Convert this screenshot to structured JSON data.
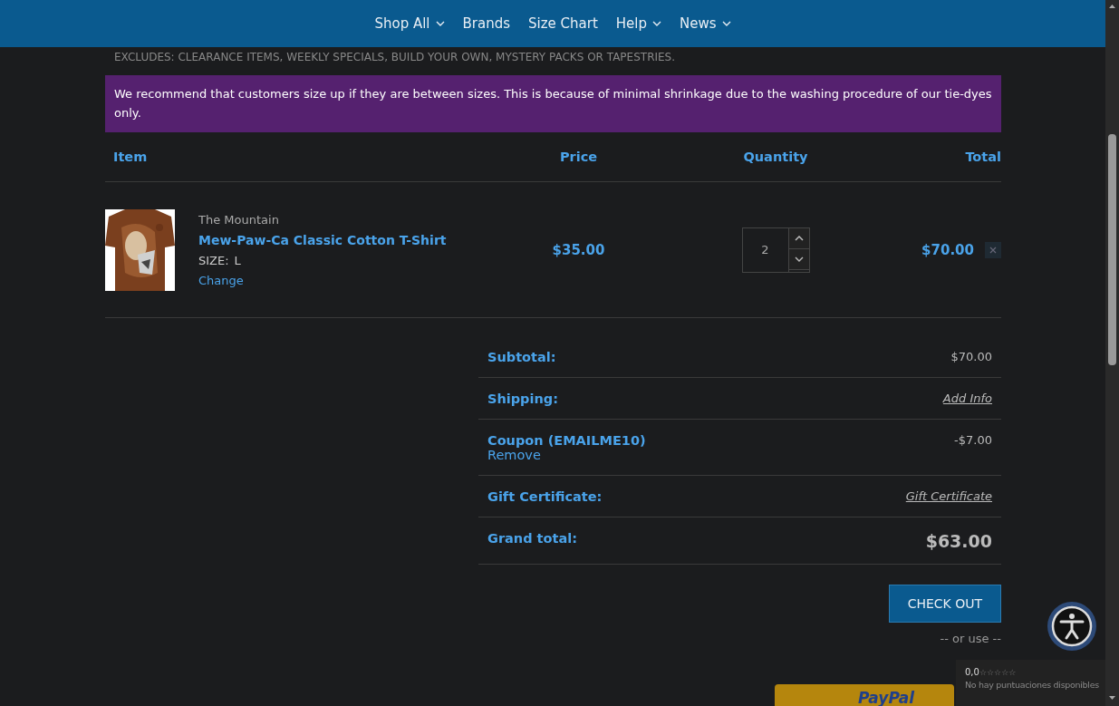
{
  "nav": [
    {
      "label": "Shop All",
      "dropdown": true
    },
    {
      "label": "Brands",
      "dropdown": false
    },
    {
      "label": "Size Chart",
      "dropdown": false
    },
    {
      "label": "Help",
      "dropdown": true
    },
    {
      "label": "News",
      "dropdown": true
    }
  ],
  "notice_line": "EXCLUDES: CLEARANCE ITEMS, WEEKLY SPECIALS, BUILD YOUR OWN, MYSTERY PACKS OR TAPESTRIES.",
  "banner": "We recommend that customers size up if they are between sizes. This is because of minimal shrinkage due to the washing procedure of our tie-dyes only.",
  "table": {
    "columns": [
      "Item",
      "Price",
      "Quantity",
      "Total"
    ],
    "rows": [
      {
        "brand": "The Mountain",
        "name": "Mew-Paw-Ca Classic Cotton T-Shirt",
        "option_label": "SIZE:",
        "option_value": "L",
        "change": "Change",
        "price": "$35.00",
        "quantity": "2",
        "total": "$70.00"
      }
    ]
  },
  "totals": [
    {
      "kind": "text",
      "label": "Subtotal:",
      "value": "$70.00"
    },
    {
      "kind": "link",
      "label": "Shipping:",
      "value": "Add Info"
    },
    {
      "kind": "coupon",
      "label": "Coupon (EMAILME10)",
      "action": "Remove",
      "value": "-$7.00"
    },
    {
      "kind": "link",
      "label": "Gift Certificate:",
      "value": "Gift Certificate"
    },
    {
      "kind": "grand",
      "label": "Grand total:",
      "value": "$63.00"
    }
  ],
  "checkout": "CHECK OUT",
  "or_use": "-- or use --",
  "paypal": "PayPal",
  "rating": {
    "score": "0,0",
    "stars": 0,
    "note": "No hay puntuaciones disponibles"
  }
}
